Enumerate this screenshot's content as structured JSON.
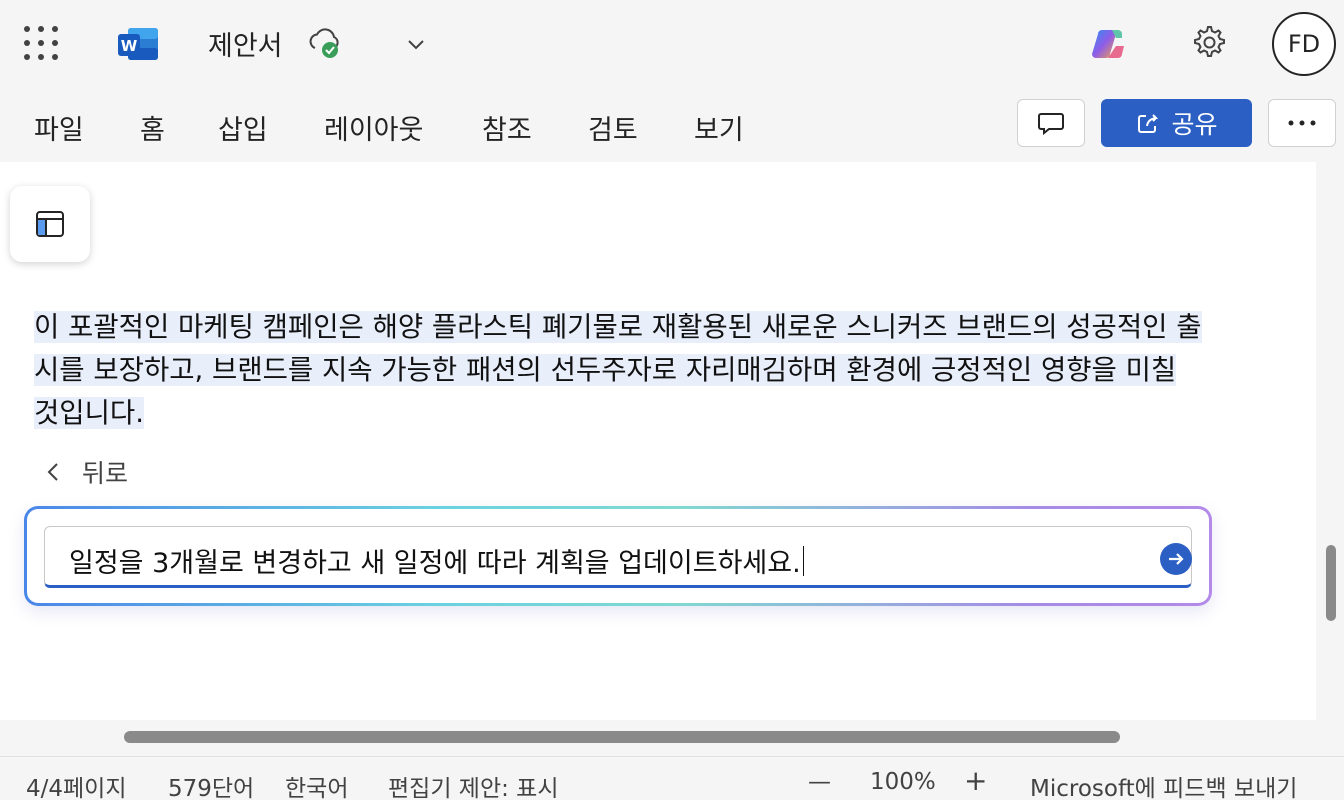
{
  "titlebar": {
    "app_icon": "word-logo",
    "doc_title": "제안서",
    "sync_icon": "cloud-check-icon",
    "avatar_initials": "FD"
  },
  "ribbon": {
    "tabs": [
      "파일",
      "홈",
      "삽입",
      "레이아웃",
      "참조",
      "검토",
      "보기"
    ],
    "share_label": "공유"
  },
  "document": {
    "selected_paragraph": "이 포괄적인 마케팅 캠페인은 해양 플라스틱 폐기물로 재활용된 새로운 스니커즈 브랜드의 성공적인 출시를 보장하고, 브랜드를 지속 가능한 패션의 선두주자로 자리매김하며 환경에 긍정적인 영향을 미칠 것입니다.",
    "back_label": "뒤로"
  },
  "copilot": {
    "prompt_value": "일정을 3개월로 변경하고 새 일정에 따라 계획을 업데이트하세요."
  },
  "statusbar": {
    "page": "4/4페이지",
    "words": "579단어",
    "language": "한국어",
    "editor": "편집기 제안: 표시",
    "zoom_out": "—",
    "zoom": "100%",
    "zoom_in": "+",
    "feedback": "Microsoft에 피드백 보내기"
  },
  "colors": {
    "accent": "#2b5fc4",
    "word_blue": "#185abd",
    "selection": "#e8eefa",
    "sync_green": "#3a9e5a"
  }
}
